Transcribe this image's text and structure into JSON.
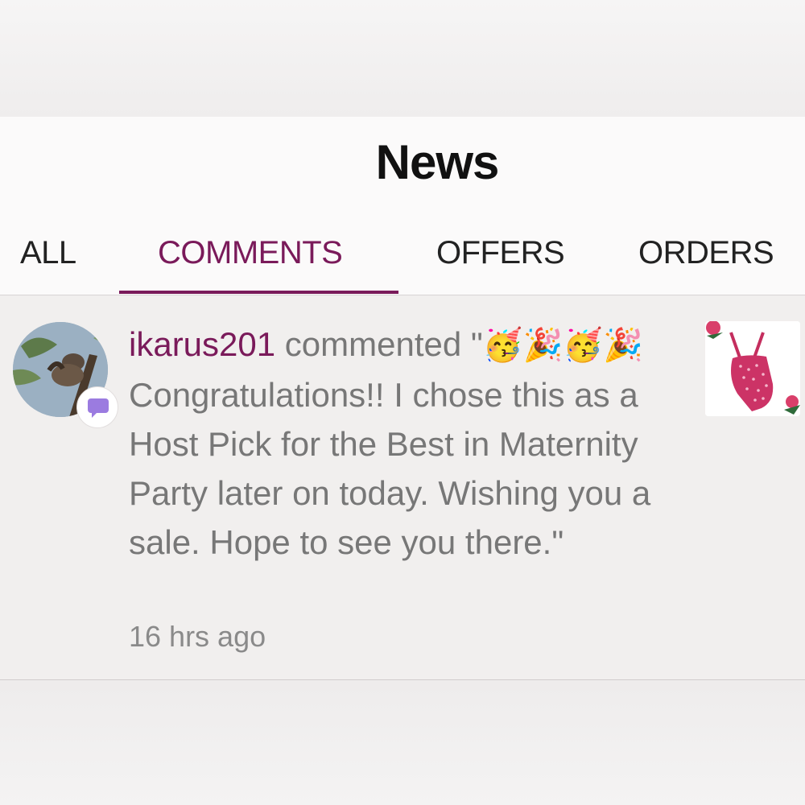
{
  "header": {
    "title": "News"
  },
  "tabs": [
    {
      "label": "ALL",
      "active": false
    },
    {
      "label": "COMMENTS",
      "active": true
    },
    {
      "label": "OFFERS",
      "active": false
    },
    {
      "label": "ORDERS",
      "active": false
    }
  ],
  "colors": {
    "accent": "#7a1a5a",
    "text_muted": "#777777"
  },
  "feed": {
    "items": [
      {
        "username": "ikarus201",
        "action": " commented \"",
        "emojis_line1": "🥳🎉",
        "emojis_line2": "🥳🎉",
        "message": "Congratulations!! I chose this as a Host Pick for the Best in Maternity Party later on today. Wishing you a sale. Hope to see you there.\"",
        "time": "16 hrs ago",
        "badge_icon": "comment-bubble-icon",
        "thumbnail_icon": "pink-swimsuit-image"
      }
    ]
  }
}
